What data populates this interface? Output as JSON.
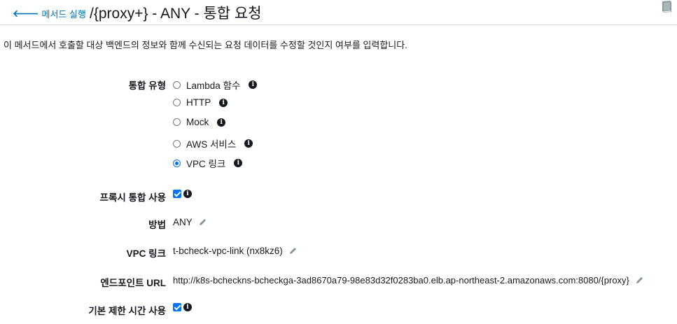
{
  "header": {
    "back_label": "메서드 실행",
    "title": "/{proxy+} - ANY - 통합 요청"
  },
  "description": "이 메서드에서 호출할 대상 백엔드의 정보와 함께 수신되는 요청 데이터를 수정할 것인지 여부를 입력합니다.",
  "integration_type": {
    "label": "통합 유형",
    "options": [
      {
        "label": "Lambda 함수",
        "selected": false
      },
      {
        "label": "HTTP",
        "selected": false
      },
      {
        "label": "Mock",
        "selected": false
      },
      {
        "label": "AWS 서비스",
        "selected": false
      },
      {
        "label": "VPC 링크",
        "selected": true
      }
    ]
  },
  "proxy_integration": {
    "label": "프록시 통합 사용",
    "checked": true
  },
  "method": {
    "label": "방법",
    "value": "ANY"
  },
  "vpc_link": {
    "label": "VPC 링크",
    "value": "t-bcheck-vpc-link (nx8kz6)"
  },
  "endpoint_url": {
    "label": "엔드포인트 URL",
    "value": "http://k8s-bcheckns-bcheckga-3ad8670a79-98e83d32f0283ba0.elb.ap-northeast-2.amazonaws.com:8080/{proxy}"
  },
  "default_timeout": {
    "label": "기본 제한 시간 사용",
    "checked": true
  },
  "colors": {
    "link": "#0073bb",
    "accent": "#0075ff",
    "text": "#16191f"
  },
  "icons": {
    "info": "info-icon",
    "edit": "pencil-icon",
    "back": "arrow-left-icon",
    "docs": "book-icon"
  }
}
